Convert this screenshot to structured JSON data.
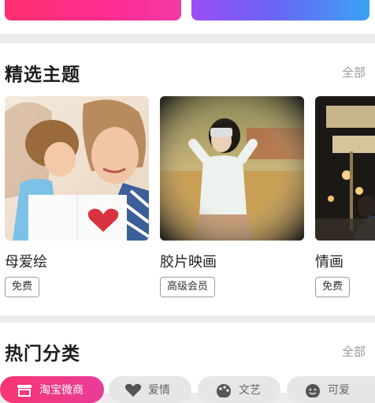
{
  "featured": {
    "title": "精选主题",
    "see_all": "全部",
    "items": [
      {
        "name": "母爱绘",
        "tag": "免费"
      },
      {
        "name": "胶片映画",
        "tag": "高级会员"
      },
      {
        "name": "情画",
        "tag": "免费"
      }
    ]
  },
  "categories": {
    "title": "热门分类",
    "see_all": "全部",
    "items": [
      {
        "label": "淘宝微商",
        "icon": "shop-icon",
        "active": true
      },
      {
        "label": "爱情",
        "icon": "heart-icon",
        "active": false
      },
      {
        "label": "文艺",
        "icon": "palette-icon",
        "active": false
      },
      {
        "label": "可爱",
        "icon": "smile-icon",
        "active": false
      }
    ]
  },
  "colors": {
    "accent_pink": "#ff2f6e",
    "accent_purple": "#6b64f4",
    "tag_border": "#9c9c9c"
  }
}
